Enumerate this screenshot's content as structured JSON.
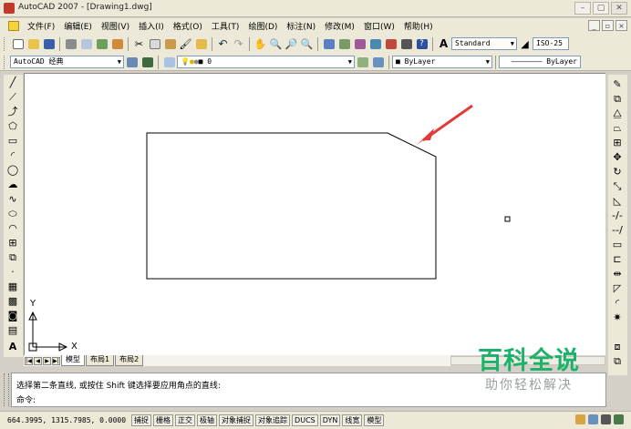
{
  "window": {
    "title": "AutoCAD 2007 - [Drawing1.dwg]"
  },
  "menu": {
    "items": [
      "文件(F)",
      "编辑(E)",
      "视图(V)",
      "插入(I)",
      "格式(O)",
      "工具(T)",
      "绘图(D)",
      "标注(N)",
      "修改(M)",
      "窗口(W)",
      "帮助(H)"
    ]
  },
  "toolbar": {
    "text_style": "Standard",
    "dim_style": "ISO-25",
    "workspace": "AutoCAD 经典",
    "layer": "0",
    "color": "ByLayer",
    "linetype": "ByLayer"
  },
  "ucs": {
    "x_label": "X",
    "y_label": "Y"
  },
  "tabs": [
    "模型",
    "布局1",
    "布局2"
  ],
  "command": {
    "prompt1": "选择第二条直线, 或按住 Shift 键选择要应用角点的直线:",
    "prompt2": "命令:"
  },
  "status": {
    "coords": "664.3995, 1315.7985, 0.0000",
    "buttons": [
      "捕捉",
      "栅格",
      "正交",
      "极轴",
      "对象捕捉",
      "对象追踪",
      "DUCS",
      "DYN",
      "线宽",
      "模型"
    ]
  },
  "watermark": {
    "title": "百科全说",
    "subtitle": "助你轻松解决"
  },
  "colors": {
    "arrow": "#e53935",
    "watermark_green": "#1db26a",
    "title_bg": "#ece9d8"
  }
}
